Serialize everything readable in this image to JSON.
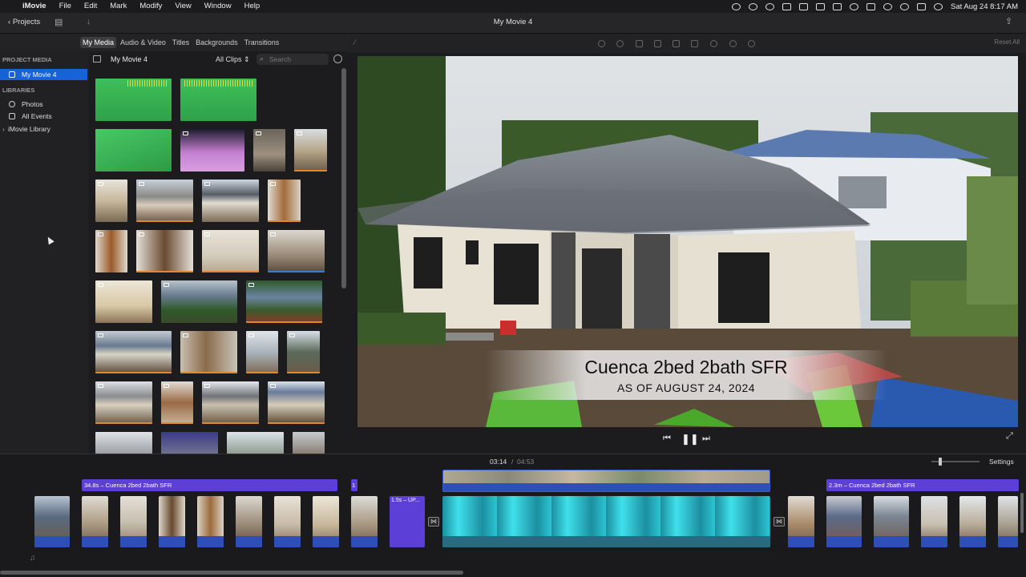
{
  "menubar": {
    "app": "iMovie",
    "items": [
      "File",
      "Edit",
      "Mark",
      "Modify",
      "View",
      "Window",
      "Help"
    ],
    "datetime": "Sat Aug 24  8:17 AM"
  },
  "toolbar": {
    "projects": "Projects",
    "title": "My Movie 4"
  },
  "media_tabs": [
    "My Media",
    "Audio & Video",
    "Titles",
    "Backgrounds",
    "Transitions"
  ],
  "sidebar": {
    "project_media_header": "PROJECT MEDIA",
    "project_item": "My Movie 4",
    "libraries_header": "LIBRARIES",
    "libraries": [
      "Photos",
      "All Events",
      "iMovie Library"
    ]
  },
  "browser": {
    "title": "My Movie 4",
    "filter": "All Clips",
    "search_placeholder": "Search"
  },
  "viewer": {
    "reset": "Reset All",
    "lower_third_line1": "Cuenca 2bed 2bath SFR",
    "lower_third_line2": "AS OF AUGUST 24, 2024"
  },
  "timeline": {
    "current": "03:14",
    "separator": "/",
    "total": "04:53",
    "settings": "Settings",
    "title_clip_1": "34.8s – Cuenca 2bed 2bath SFR",
    "title_clip_2": "1",
    "title_clip_3": "1.5s – UP...",
    "title_clip_4": "2.3m – Cuenca 2bed 2bath SFR"
  },
  "colors": {
    "accent": "#1763d6",
    "title_clip": "#5b3fd6",
    "audio_green": "#3fbf5a",
    "cyan_clip": "#2bc4d4"
  }
}
